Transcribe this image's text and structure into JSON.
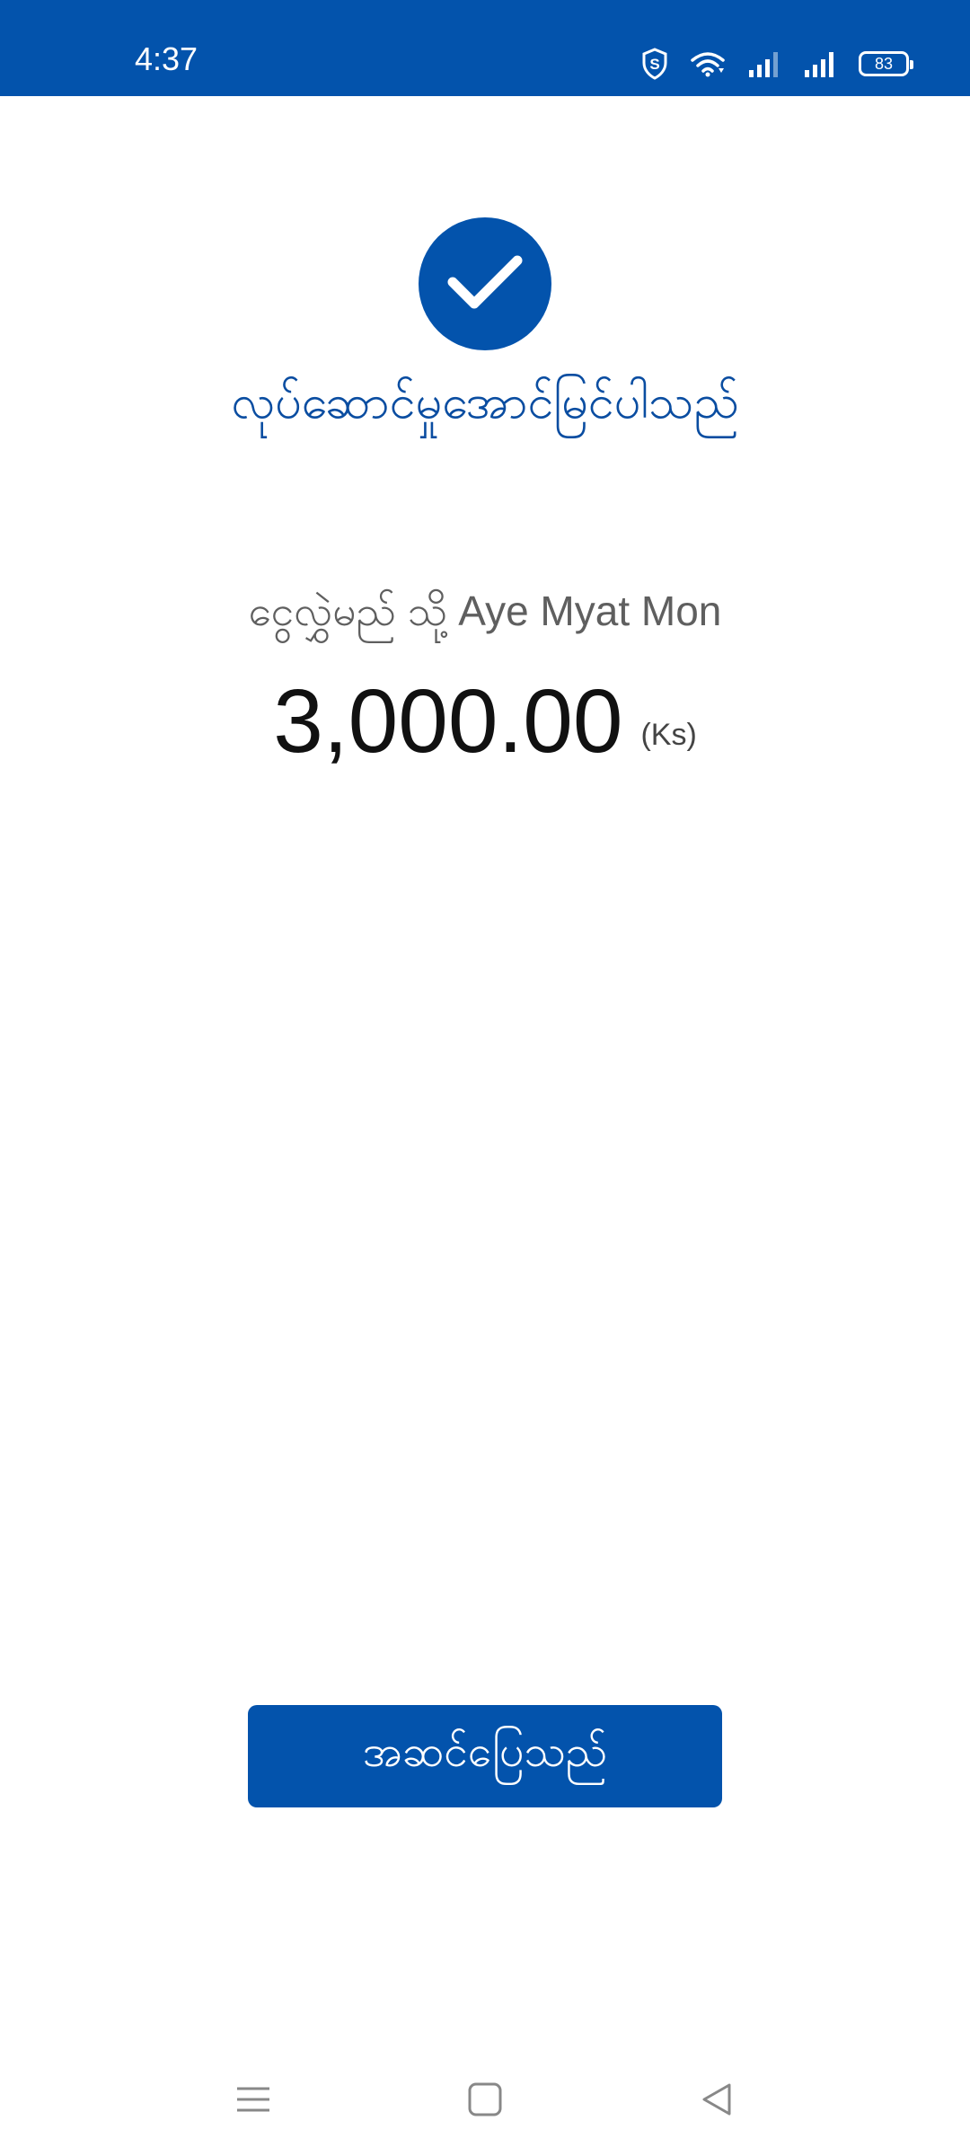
{
  "status_bar": {
    "time": "4:37",
    "battery_level": "83",
    "icons": [
      "shield-s-icon",
      "wifi-icon",
      "cellular-signal-icon",
      "cellular-signal-icon",
      "battery-icon"
    ]
  },
  "success": {
    "icon": "checkmark-icon",
    "title": "လုပ်ဆောင်မှုအောင်မြင်ပါသည်"
  },
  "transfer": {
    "recipient_prefix": "ငွေလွှဲမည် သို့",
    "recipient_name": "Aye Myat Mon",
    "amount": "3,000.00",
    "currency": "(Ks)"
  },
  "actions": {
    "done_label": "အဆင်ပြေသည်"
  },
  "nav": {
    "icons": [
      "menu-icon",
      "home-square-icon",
      "back-triangle-icon"
    ]
  },
  "colors": {
    "primary": "#0353ac",
    "title_text": "#0a4da1",
    "background": "#ffffff"
  }
}
